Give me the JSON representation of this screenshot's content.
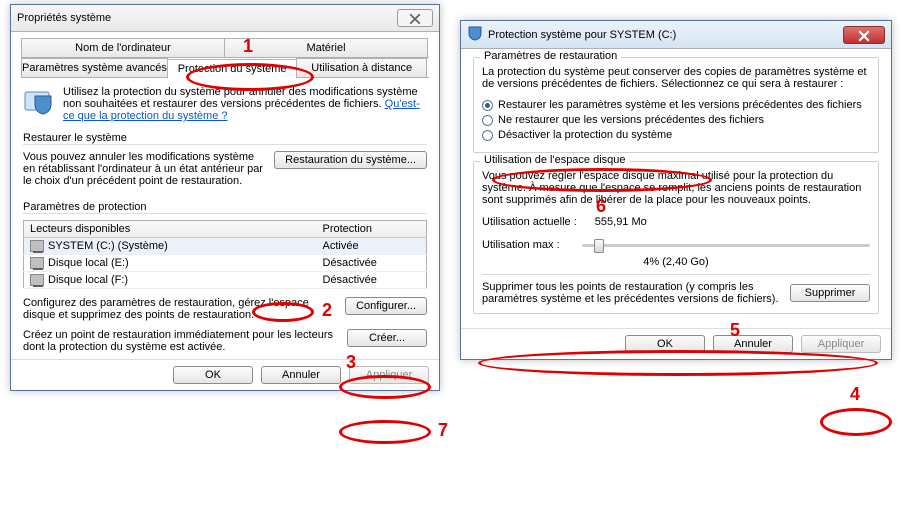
{
  "left": {
    "title": "Propriétés système",
    "tabs": {
      "computer_name": "Nom de l'ordinateur",
      "hardware": "Matériel",
      "advanced": "Paramètres système avancés",
      "protection": "Protection du système",
      "remote": "Utilisation à distance"
    },
    "intro": {
      "text": "Utilisez la protection du système pour annuler des modifications système non souhaitées et restaurer des versions précédentes de fichiers. ",
      "link": "Qu'est-ce que la protection du système ?"
    },
    "restore": {
      "legend": "Restaurer le système",
      "text": "Vous pouvez annuler les modifications système en rétablissant l'ordinateur à un état antérieur par le choix d'un précédent point de restauration.",
      "button": "Restauration du système..."
    },
    "protection": {
      "legend": "Paramètres de protection",
      "col_drives": "Lecteurs disponibles",
      "col_status": "Protection",
      "drives": [
        {
          "name": "SYSTEM (C:) (Système)",
          "status": "Activée",
          "selected": true
        },
        {
          "name": "Disque local (E:)",
          "status": "Désactivée",
          "selected": false
        },
        {
          "name": "Disque local (F:)",
          "status": "Désactivée",
          "selected": false
        }
      ],
      "configure_text": "Configurez des paramètres de restauration, gérez l'espace disque et supprimez des points de restauration.",
      "configure_btn": "Configurer...",
      "create_text": "Créez un point de restauration immédiatement pour les lecteurs dont la protection du système est activée.",
      "create_btn": "Créer..."
    },
    "buttons": {
      "ok": "OK",
      "cancel": "Annuler",
      "apply": "Appliquer"
    }
  },
  "right": {
    "title": "Protection système pour SYSTEM (C:)",
    "restore": {
      "legend": "Paramètres de restauration",
      "text": "La protection du système peut conserver des copies de paramètres système et de versions précédentes de fichiers. Sélectionnez ce qui sera à restaurer :",
      "opt_full": "Restaurer les paramètres système et les versions précédentes des fichiers",
      "opt_files": "Ne restaurer que les versions précédentes des fichiers",
      "opt_off": "Désactiver la protection du système"
    },
    "disk": {
      "legend": "Utilisation de l'espace disque",
      "text": "Vous pouvez régler l'espace disque maximal utilisé pour la protection du système. À mesure que l'espace se remplit, les anciens points de restauration sont supprimés afin de libérer de la place pour les nouveaux points.",
      "current_label": "Utilisation actuelle :",
      "current_value": "555,91 Mo",
      "max_label": "Utilisation max :",
      "max_value": "4% (2,40 Go)",
      "delete_text": "Supprimer tous les points de restauration (y compris les paramètres système et les précédentes versions de fichiers).",
      "delete_btn": "Supprimer"
    },
    "buttons": {
      "ok": "OK",
      "cancel": "Annuler",
      "apply": "Appliquer"
    }
  },
  "annotations": {
    "a1": "1",
    "a2": "2",
    "a3": "3",
    "a4": "4",
    "a5": "5",
    "a6": "6",
    "a7": "7"
  }
}
